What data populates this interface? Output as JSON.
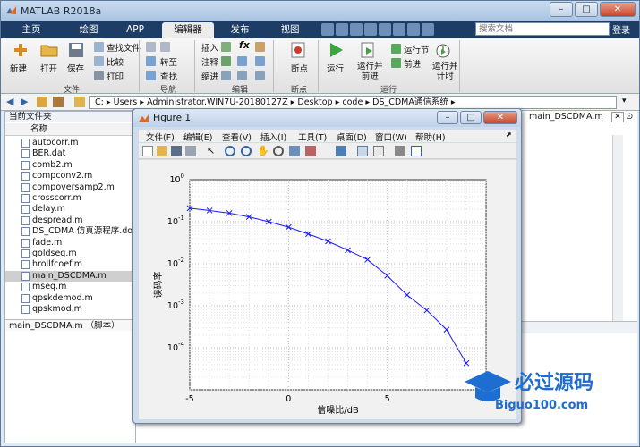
{
  "app": {
    "title": "MATLAB R2018a",
    "search_placeholder": "搜索文档",
    "login": "登录"
  },
  "tabs": [
    {
      "label": "主页"
    },
    {
      "label": "绘图"
    },
    {
      "label": "APP"
    },
    {
      "label": "编辑器"
    },
    {
      "label": "发布"
    },
    {
      "label": "视图"
    }
  ],
  "ribbon": {
    "file": {
      "new": "新建",
      "open": "打开",
      "save": "保存",
      "find_files": "查找文件",
      "compare": "比较",
      "print": "打印",
      "group": "文件"
    },
    "nav": {
      "goto": "转至",
      "find": "查找",
      "group": "导航"
    },
    "edit": {
      "insert": "插入",
      "comment": "注释",
      "indent": "缩进",
      "fx": "fx",
      "group": "编辑"
    },
    "breakpoints": {
      "label": "断点",
      "group": "断点"
    },
    "run": {
      "run": "运行",
      "run_advance": "运行并\n前进",
      "run_section": "运行节",
      "advance": "前进",
      "run_time": "运行并\n计时",
      "group": "运行"
    }
  },
  "path": {
    "segments": [
      "C:",
      "Users",
      "Administrator.WIN7U-20180127Z",
      "Desktop",
      "code",
      "DS_CDMA通信系统"
    ]
  },
  "file_browser": {
    "title": "当前文件夹",
    "column": "名称",
    "files": [
      "autocorr.m",
      "BER.dat",
      "comb2.m",
      "compconv2.m",
      "compoversamp2.m",
      "crosscorr.m",
      "delay.m",
      "despread.m",
      "DS_CDMA 仿真源程序.doc",
      "fade.m",
      "goldseq.m",
      "hrollfcoef.m",
      "main_DSCDMA.m",
      "mseq.m",
      "qpskdemod.m",
      "qpskmod.m"
    ],
    "selected_index": 12,
    "detail": "main_DSCDMA.m （脚本）"
  },
  "editor": {
    "tab_label": "main_DSCDMA.m"
  },
  "figure": {
    "title": "Figure 1",
    "menu": [
      "文件(F)",
      "编辑(E)",
      "查看(V)",
      "插入(I)",
      "工具(T)",
      "桌面(D)",
      "窗口(W)",
      "帮助(H)"
    ]
  },
  "chart_data": {
    "type": "line",
    "xlabel": "信噪比/dB",
    "ylabel": "误码率",
    "xlim": [
      -5,
      10
    ],
    "ylim": [
      1e-05,
      1
    ],
    "yscale": "log",
    "grid": true,
    "xticks": [
      "-5",
      "0",
      "5",
      "10"
    ],
    "yticks": [
      "10^0",
      "10^-1",
      "10^-2",
      "10^-3",
      "10^-4"
    ],
    "series": [
      {
        "color": "#1a1aff",
        "marker": "x",
        "x": [
          -5,
          -4,
          -3,
          -2,
          -1,
          0,
          1,
          2,
          3,
          4,
          5,
          6,
          7,
          8,
          9
        ],
        "y": [
          0.21,
          0.185,
          0.16,
          0.13,
          0.1,
          0.074,
          0.051,
          0.034,
          0.021,
          0.0125,
          0.0052,
          0.0018,
          0.00078,
          0.00027,
          4.3e-05
        ]
      }
    ]
  },
  "watermark": {
    "text": "必过源码",
    "url": "Biguo100.com"
  }
}
